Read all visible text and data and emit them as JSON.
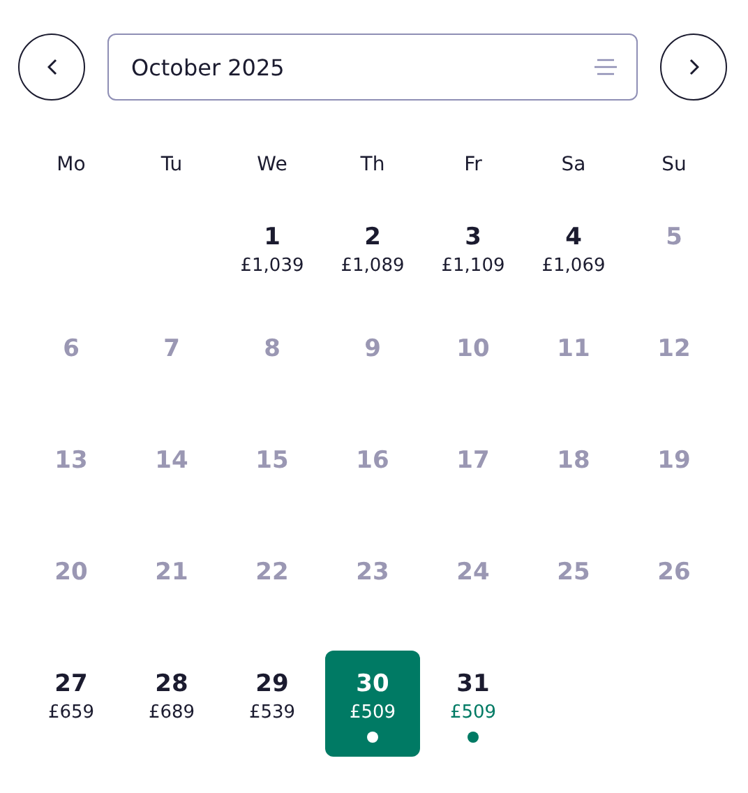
{
  "month_field": {
    "value": "October 2025"
  },
  "weekdays": [
    "Mo",
    "Tu",
    "We",
    "Th",
    "Fr",
    "Sa",
    "Su"
  ],
  "weeks": [
    [
      {
        "kind": "empty"
      },
      {
        "kind": "empty"
      },
      {
        "kind": "day",
        "day": "1",
        "price": "£1,039",
        "available": true,
        "selected": false,
        "deal": false
      },
      {
        "kind": "day",
        "day": "2",
        "price": "£1,089",
        "available": true,
        "selected": false,
        "deal": false
      },
      {
        "kind": "day",
        "day": "3",
        "price": "£1,109",
        "available": true,
        "selected": false,
        "deal": false
      },
      {
        "kind": "day",
        "day": "4",
        "price": "£1,069",
        "available": true,
        "selected": false,
        "deal": false
      },
      {
        "kind": "day",
        "day": "5",
        "available": false,
        "selected": false,
        "deal": false
      }
    ],
    [
      {
        "kind": "day",
        "day": "6",
        "available": false,
        "selected": false,
        "deal": false
      },
      {
        "kind": "day",
        "day": "7",
        "available": false,
        "selected": false,
        "deal": false
      },
      {
        "kind": "day",
        "day": "8",
        "available": false,
        "selected": false,
        "deal": false
      },
      {
        "kind": "day",
        "day": "9",
        "available": false,
        "selected": false,
        "deal": false
      },
      {
        "kind": "day",
        "day": "10",
        "available": false,
        "selected": false,
        "deal": false
      },
      {
        "kind": "day",
        "day": "11",
        "available": false,
        "selected": false,
        "deal": false
      },
      {
        "kind": "day",
        "day": "12",
        "available": false,
        "selected": false,
        "deal": false
      }
    ],
    [
      {
        "kind": "day",
        "day": "13",
        "available": false,
        "selected": false,
        "deal": false
      },
      {
        "kind": "day",
        "day": "14",
        "available": false,
        "selected": false,
        "deal": false
      },
      {
        "kind": "day",
        "day": "15",
        "available": false,
        "selected": false,
        "deal": false
      },
      {
        "kind": "day",
        "day": "16",
        "available": false,
        "selected": false,
        "deal": false
      },
      {
        "kind": "day",
        "day": "17",
        "available": false,
        "selected": false,
        "deal": false
      },
      {
        "kind": "day",
        "day": "18",
        "available": false,
        "selected": false,
        "deal": false
      },
      {
        "kind": "day",
        "day": "19",
        "available": false,
        "selected": false,
        "deal": false
      }
    ],
    [
      {
        "kind": "day",
        "day": "20",
        "available": false,
        "selected": false,
        "deal": false
      },
      {
        "kind": "day",
        "day": "21",
        "available": false,
        "selected": false,
        "deal": false
      },
      {
        "kind": "day",
        "day": "22",
        "available": false,
        "selected": false,
        "deal": false
      },
      {
        "kind": "day",
        "day": "23",
        "available": false,
        "selected": false,
        "deal": false
      },
      {
        "kind": "day",
        "day": "24",
        "available": false,
        "selected": false,
        "deal": false
      },
      {
        "kind": "day",
        "day": "25",
        "available": false,
        "selected": false,
        "deal": false
      },
      {
        "kind": "day",
        "day": "26",
        "available": false,
        "selected": false,
        "deal": false
      }
    ],
    [
      {
        "kind": "day",
        "day": "27",
        "price": "£659",
        "available": true,
        "selected": false,
        "deal": false
      },
      {
        "kind": "day",
        "day": "28",
        "price": "£689",
        "available": true,
        "selected": false,
        "deal": false
      },
      {
        "kind": "day",
        "day": "29",
        "price": "£539",
        "available": true,
        "selected": false,
        "deal": false
      },
      {
        "kind": "day",
        "day": "30",
        "price": "£509",
        "available": true,
        "selected": true,
        "deal": true
      },
      {
        "kind": "day",
        "day": "31",
        "price": "£509",
        "available": true,
        "selected": false,
        "deal": true
      }
    ]
  ]
}
